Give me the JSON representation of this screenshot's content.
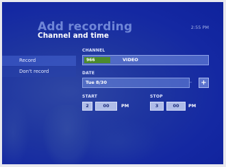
{
  "header": {
    "title": "Add recording",
    "subtitle": "Channel and time",
    "clock": "2:55 PM"
  },
  "menu": {
    "items": [
      {
        "label": "Record"
      },
      {
        "label": "Don't record"
      }
    ]
  },
  "channel": {
    "label": "CHANNEL",
    "number": "966",
    "name": "VIDEO"
  },
  "date": {
    "label": "DATE",
    "value": "Tue 8/30",
    "minus_glyph": "−",
    "plus_glyph": "+"
  },
  "start": {
    "label": "START",
    "hour": "2",
    "minute": "00",
    "ampm": "PM"
  },
  "stop": {
    "label": "STOP",
    "hour": "3",
    "minute": "00",
    "ampm": "PM"
  },
  "colors": {
    "background": "#1428a2",
    "title": "#6f86d8",
    "channel_highlight": "#4c8a2e"
  }
}
